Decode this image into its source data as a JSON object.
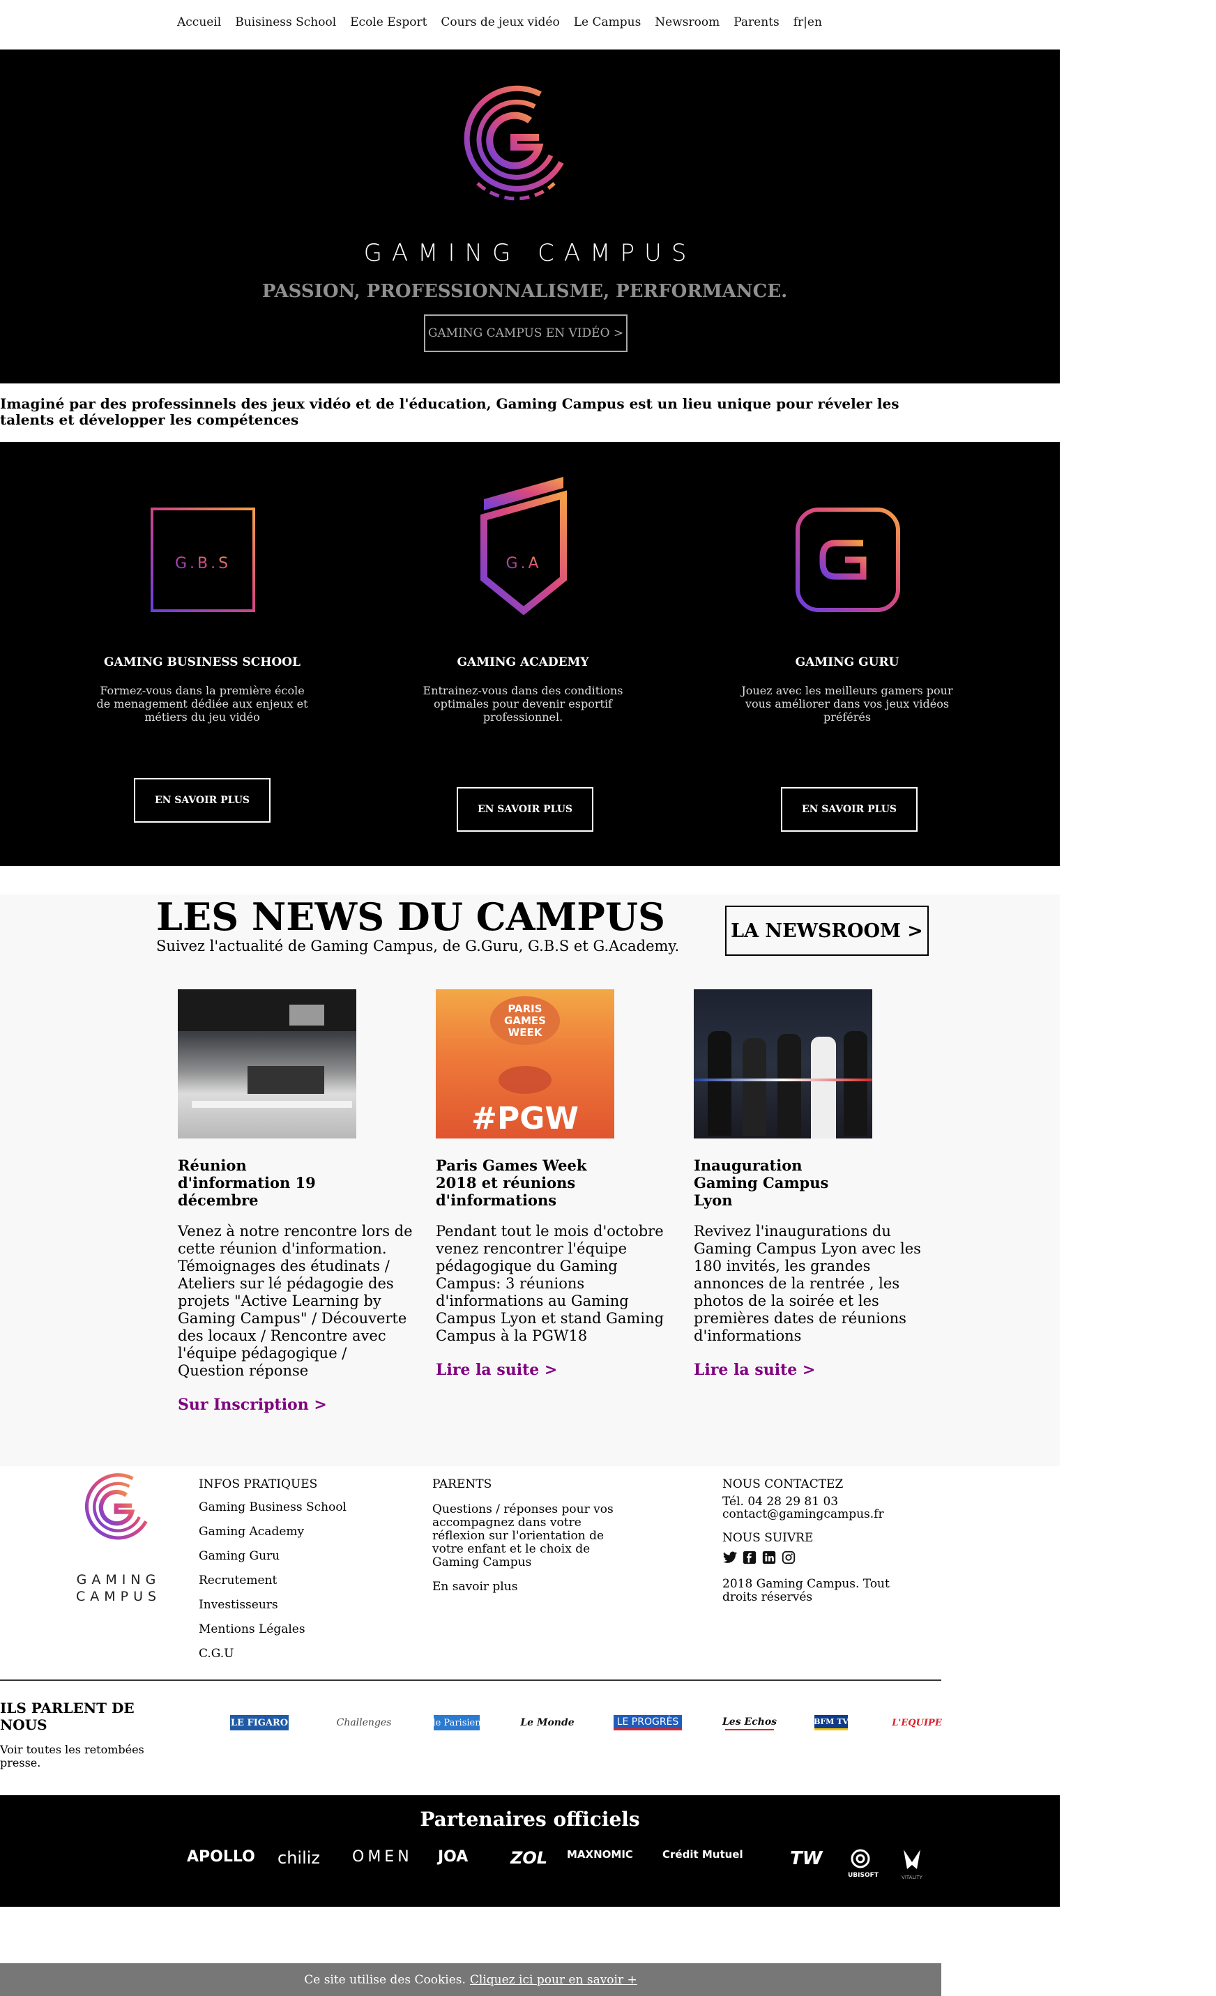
{
  "nav": {
    "items": [
      "Accueil",
      "Buisiness School",
      "Ecole Esport",
      "Cours de jeux vidéo",
      "Le Campus",
      "Newsroom",
      "Parents",
      "fr|en"
    ]
  },
  "hero": {
    "brand": "GAMING CAMPUS",
    "tagline": "PASSION, PROFESSIONNALISME, PERFORMANCE.",
    "video_button": "GAMING CAMPUS EN VIDÉO >",
    "logo_gradient": [
      "#7b3fe4",
      "#e04c7a",
      "#f39a4b"
    ]
  },
  "intro": "Imaginé par des professinnels des jeux vidéo et de l'éducation, Gaming Campus est un lieu unique pour réveler les talents et développer les compétences",
  "schools": [
    {
      "logo_text": "G.B.S",
      "title": "GAMING BUSINESS SCHOOL",
      "desc": "Formez-vous dans la première école de menagement dédiée aux enjeux et métiers du jeu vidéo",
      "button": "EN SAVOIR PLUS"
    },
    {
      "logo_text": "G.A",
      "title": "GAMING ACADEMY",
      "desc": "Entrainez-vous dans des conditions optimales pour devenir esportif professionnel.",
      "button": "EN SAVOIR PLUS"
    },
    {
      "logo_text": "",
      "title": "GAMING GURU",
      "desc": "Jouez avec les meilleurs gamers pour vous améliorer dans vos jeux vidéos préférés",
      "button": "EN SAVOIR PLUS"
    }
  ],
  "news": {
    "heading": "LES NEWS DU CAMPUS",
    "subtitle": "Suivez l'actualité de Gaming Campus, de G.Guru, G.B.S et G.Academy.",
    "newsroom_button": "LA NEWSROOM >",
    "cards": [
      {
        "title": "Réunion d'information 19 décembre",
        "text": "Venez à notre rencontre lors de cette réunion d'information. Témoignages des étudinats / Ateliers sur lé pédagogie des projets \"Active Learning by Gaming Campus\" / Découverte des locaux / Rencontre avec l'équipe pédagogique / Question réponse",
        "link": "Sur Inscription >"
      },
      {
        "title": "Paris Games Week 2018 et réunions d'informations",
        "text": "Pendant tout le mois d'octobre venez rencontrer l'équipe pédagogique du Gaming Campus: 3 réunions d'informations au Gaming Campus Lyon et stand Gaming Campus à la PGW18",
        "link": "Lire la suite >",
        "image_text": {
          "top": "PARIS GAMES WEEK",
          "bottom": "#PGW"
        }
      },
      {
        "title": "Inauguration Gaming Campus Lyon",
        "text": "Revivez l'inaugurations du Gaming Campus Lyon avec les 180 invités, les grandes annonces de la rentrée , les photos de la soirée et les premières dates de réunions d'informations",
        "link": "Lire la suite >"
      }
    ]
  },
  "footer": {
    "logo_line1": "GAMING",
    "logo_line2": "CAMPUS",
    "infos": {
      "heading": "INFOS PRATIQUES",
      "items": [
        "Gaming Business School",
        "Gaming Academy",
        "Gaming Guru",
        "Recrutement",
        "Investisseurs",
        "Mentions Légales",
        "C.G.U"
      ]
    },
    "parents": {
      "heading": "PARENTS",
      "text": "Questions / réponses pour vos accompagnez dans votre réflexion sur l'orientation de votre enfant et le choix de Gaming Campus",
      "link": "En savoir plus"
    },
    "contact": {
      "heading": "NOUS CONTACTEZ",
      "phone": "Tél. 04 28 29 81 03",
      "email": "contact@gamingcampus.fr",
      "follow": "NOUS SUIVRE",
      "copyright": "2018 Gaming Campus. Tout droits réservés"
    }
  },
  "press": {
    "heading": "ILS PARLENT DE NOUS",
    "text": "Voir toutes les retombées presse.",
    "logos": [
      "LE FIGARO",
      "Challenges",
      "le Parisien",
      "Le Monde",
      "LE PROGRÈS",
      "Les Echos",
      "BFM TV",
      "L'EQUIPE"
    ]
  },
  "partners": {
    "heading": "Partenaires officiels",
    "logos": [
      "APOLLO",
      "chiliz",
      "OMEN",
      "JOA",
      "ZOL",
      "MAXNOMIC",
      "Crédit Mutuel",
      "TW",
      "UBISOFT",
      "VITALITY"
    ]
  },
  "cookie": {
    "text": "Ce site utilise des Cookies.",
    "link": "Cliquez ici pour en savoir +"
  }
}
